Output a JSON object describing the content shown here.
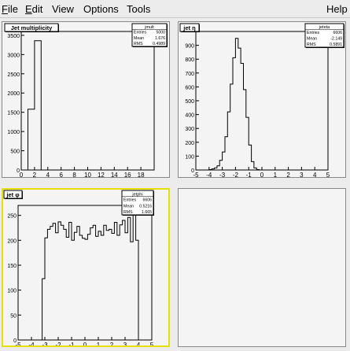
{
  "menubar": {
    "items": [
      {
        "label": "File",
        "ul": "F",
        "rest": "ile"
      },
      {
        "label": "Edit",
        "ul": "E",
        "rest": "dit"
      },
      {
        "label": "View",
        "ul": "",
        "rest": "View"
      },
      {
        "label": "Options",
        "ul": "",
        "rest": "Options"
      },
      {
        "label": "Tools",
        "ul": "",
        "rest": "Tools"
      }
    ],
    "help": "Help"
  },
  "colors": {
    "active_pad_border": "#e8e000",
    "pad_bg": "#f4f4f4",
    "line": "#000000"
  },
  "chart_data": [
    {
      "type": "bar",
      "title": "Jet multiplicity",
      "stats": {
        "name": "jmult",
        "rows": [
          [
            "Entries",
            "5000"
          ],
          [
            "Mean",
            "1.676"
          ],
          [
            "RMS",
            "0.4989"
          ]
        ]
      },
      "xlim": [
        0,
        20
      ],
      "ylim": [
        0,
        3600
      ],
      "xticks": [
        0,
        2,
        4,
        6,
        8,
        10,
        12,
        14,
        16,
        18
      ],
      "yticks": [
        0,
        500,
        1000,
        1500,
        2000,
        2500,
        3000,
        3500
      ],
      "bins": {
        "edges": [
          1,
          2,
          3
        ],
        "values": [
          1580,
          3360
        ]
      }
    },
    {
      "type": "bar",
      "title": "jet η",
      "stats": {
        "name": "jeteta",
        "rows": [
          [
            "Entries",
            "6606"
          ],
          [
            "Mean",
            "-2.149"
          ],
          [
            "RMS",
            "0.5891"
          ]
        ]
      },
      "xlim": [
        -5,
        5
      ],
      "ylim": [
        0,
        1000
      ],
      "xticks": [
        -5,
        -4,
        -3,
        -2,
        -1,
        0,
        1,
        2,
        3,
        4,
        5
      ],
      "yticks": [
        0,
        100,
        200,
        300,
        400,
        500,
        600,
        700,
        800,
        900
      ],
      "bins": {
        "start": -4.0,
        "width": 0.2,
        "values": [
          3,
          8,
          15,
          30,
          70,
          130,
          240,
          420,
          620,
          810,
          950,
          880,
          770,
          580,
          380,
          180,
          60,
          15,
          3
        ]
      }
    },
    {
      "type": "bar",
      "title": "jet φ",
      "stats": {
        "name": "jetphi",
        "rows": [
          [
            "Entries",
            "6606"
          ],
          [
            "Mean",
            "0.5216"
          ],
          [
            "RMS",
            "1.665"
          ]
        ]
      },
      "xlim": [
        -5,
        5
      ],
      "ylim": [
        0,
        270
      ],
      "xticks": [
        -5,
        -4,
        -3,
        -2,
        -1,
        0,
        1,
        2,
        3,
        4,
        5
      ],
      "yticks": [
        0,
        50,
        100,
        150,
        200,
        250
      ],
      "bins": {
        "start": -3.2,
        "width": 0.2,
        "values": [
          123,
          205,
          222,
          228,
          234,
          215,
          237,
          230,
          222,
          206,
          236,
          200,
          216,
          228,
          210,
          204,
          202,
          212,
          225,
          230,
          208,
          218,
          210,
          230,
          220,
          222,
          214,
          236,
          210,
          231,
          240,
          215,
          246,
          197,
          260,
          200
        ]
      }
    }
  ]
}
